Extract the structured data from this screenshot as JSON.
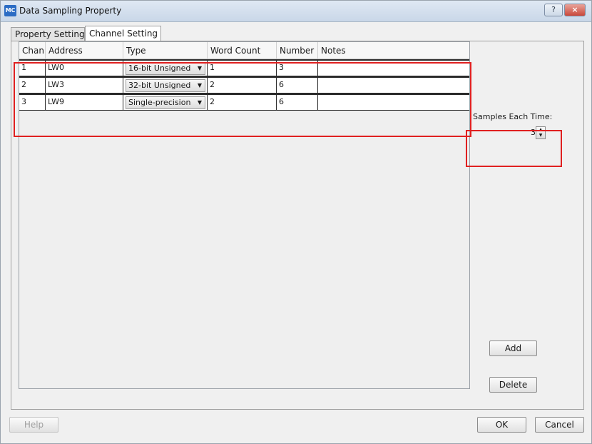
{
  "window": {
    "icon_text": "MC",
    "title": "Data Sampling Property",
    "help_glyph": "?",
    "close_glyph": "×"
  },
  "tabs": [
    {
      "label": "Property Setting",
      "selected": false
    },
    {
      "label": "Channel Setting",
      "selected": true
    }
  ],
  "table": {
    "columns": [
      "Chan",
      "Address",
      "Type",
      "Word Count",
      "Number",
      "Notes"
    ],
    "rows": [
      {
        "chan": "1",
        "address": "LW0",
        "type": "16-bit Unsigned",
        "word_count": "1",
        "number": "3",
        "notes": ""
      },
      {
        "chan": "2",
        "address": "LW3",
        "type": "32-bit Unsigned",
        "word_count": "2",
        "number": "6",
        "notes": ""
      },
      {
        "chan": "3",
        "address": "LW9",
        "type": "Single-precision",
        "word_count": "2",
        "number": "6",
        "notes": ""
      }
    ]
  },
  "samples": {
    "label": "Samples Each Time:",
    "value": "3"
  },
  "buttons": {
    "add": "Add",
    "delete": "Delete",
    "help": "Help",
    "ok": "OK",
    "cancel": "Cancel"
  },
  "colors": {
    "highlight": "#e02020",
    "close_button": "#c9483a"
  }
}
